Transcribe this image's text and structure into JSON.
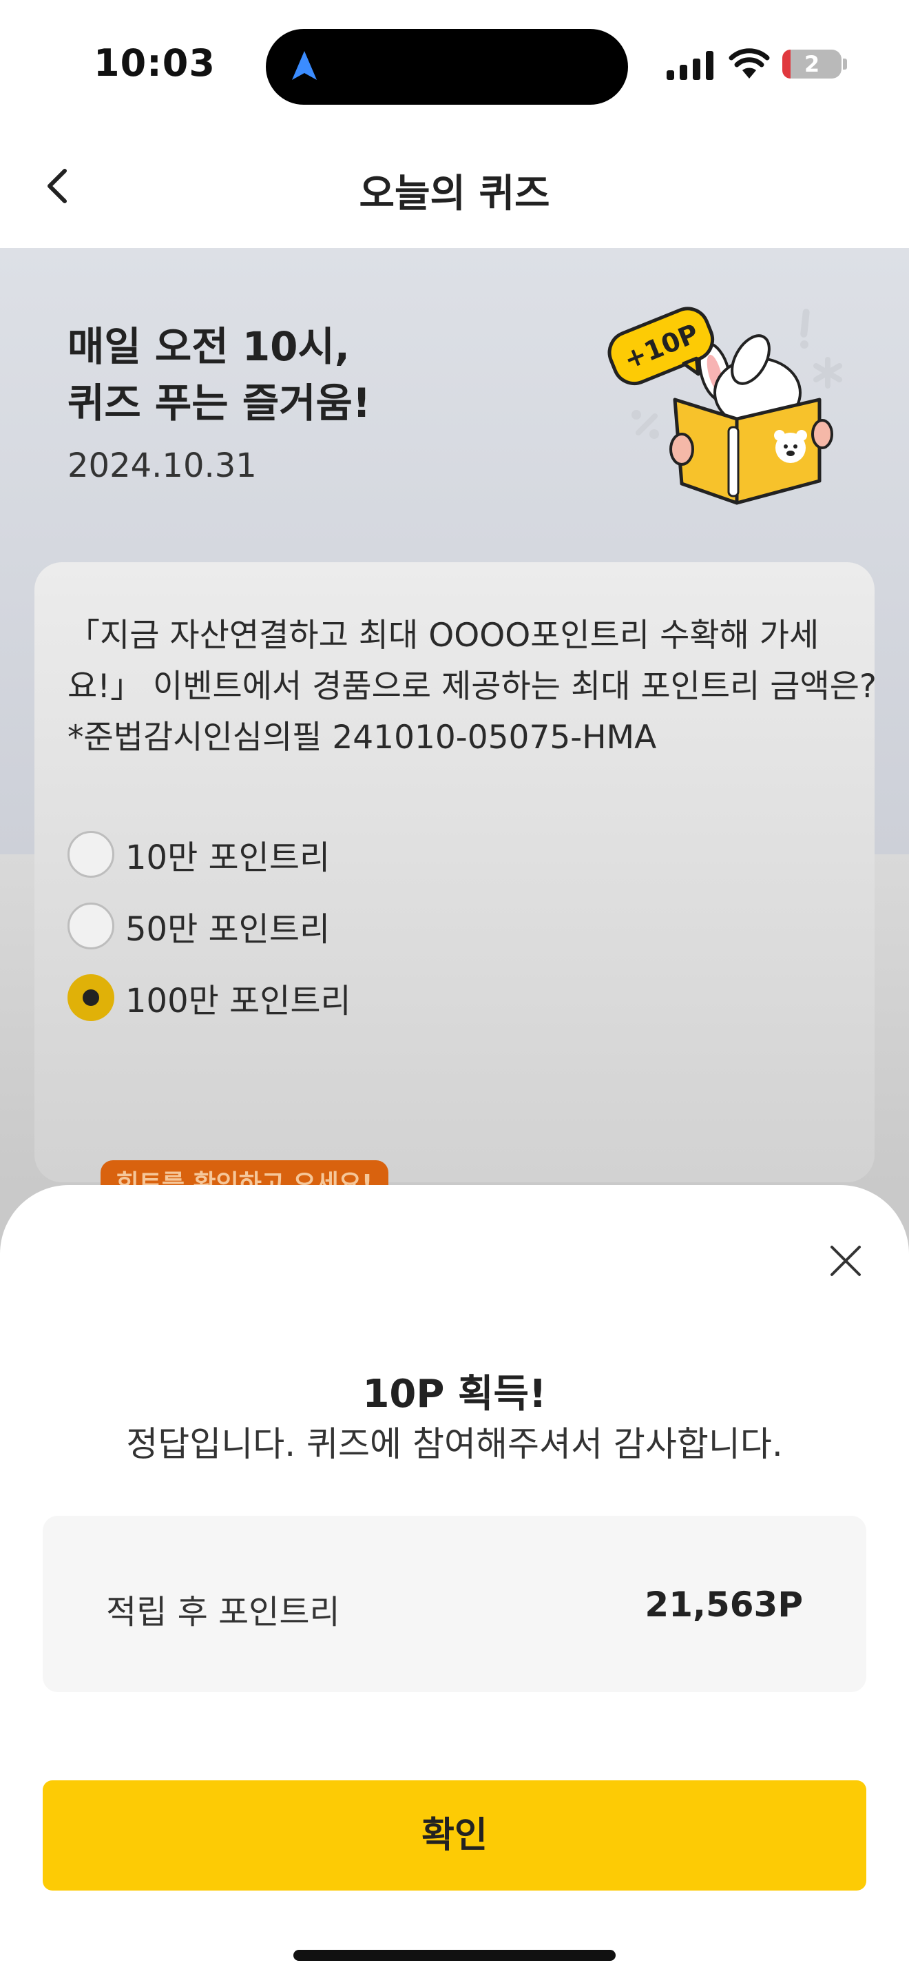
{
  "status_bar": {
    "time": "10:03",
    "battery_level": "2",
    "icons": [
      "location-arrow-icon",
      "signal-icon",
      "wifi-icon",
      "battery-icon"
    ]
  },
  "header": {
    "title": "오늘의 퀴즈",
    "back_icon": "chevron-left-icon"
  },
  "hero": {
    "title_line1": "매일 오전 10시,",
    "title_line2": "퀴즈 푸는 즐거움!",
    "date": "2024.10.31",
    "badge": "+10P"
  },
  "quiz": {
    "question_line1": "「지금 자산연결하고 최대 OOOO포인트리 수확해 가세",
    "question_line2": "요!」 이벤트에서 경품으로 제공하는 최대 포인트리 금액은?",
    "question_line3": "*준법감시인심의필 241010-05075-HMA",
    "options": [
      {
        "label": "10만 포인트리",
        "selected": false
      },
      {
        "label": "50만 포인트리",
        "selected": false
      },
      {
        "label": "100만 포인트리",
        "selected": true
      }
    ],
    "hint_button": "힌트를 확인하고 오세요!"
  },
  "result_sheet": {
    "title": "10P 획득!",
    "message": "정답입니다. 퀴즈에 참여해주셔서 감사합니다.",
    "points_label": "적립 후 포인트리",
    "points_value": "21,563P",
    "confirm_label": "확인",
    "close_icon": "close-icon"
  },
  "colors": {
    "accent_yellow": "#fdcb05",
    "radio_selected": "#e0b108",
    "hint_orange": "#d9620e",
    "background": "#dde0e6"
  }
}
